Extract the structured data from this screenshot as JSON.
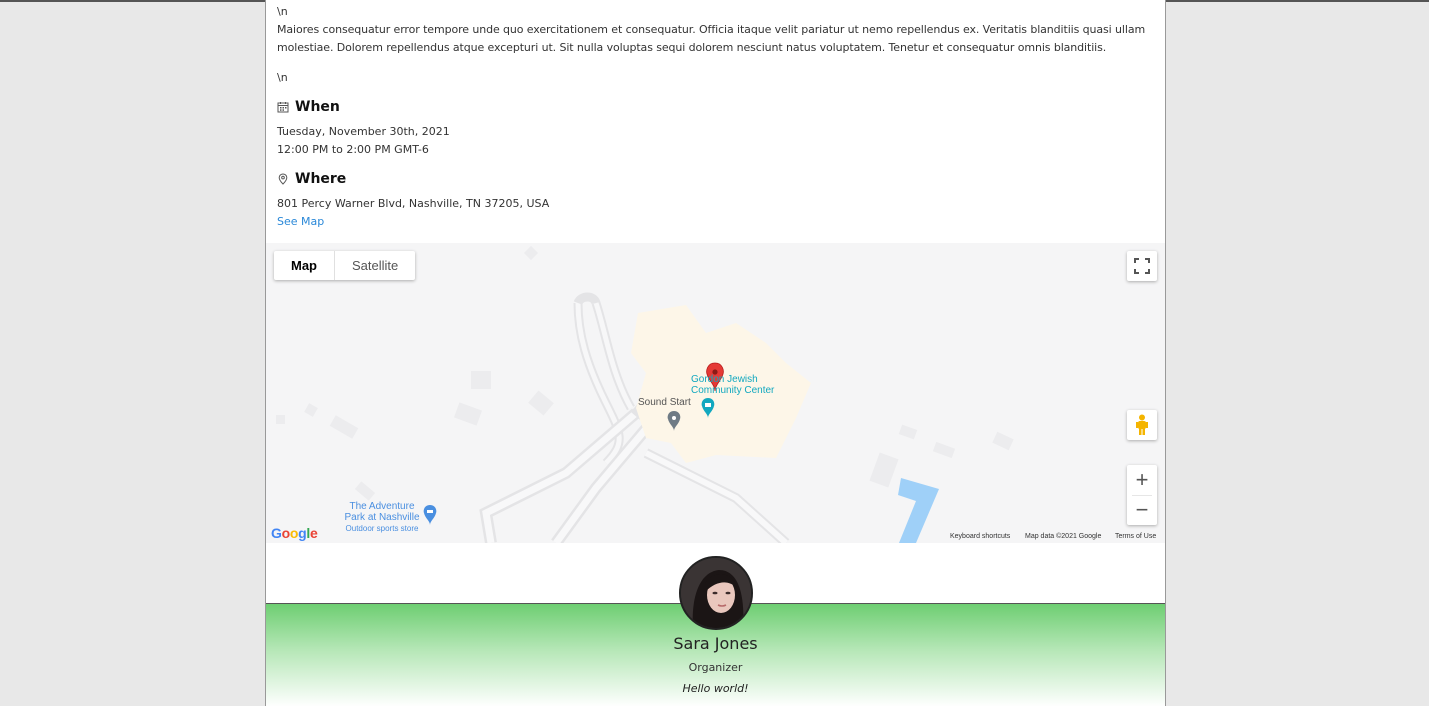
{
  "event": {
    "literal_top": "\\n",
    "description": "Maiores consequatur error tempore unde quo exercitationem et consequatur. Officia itaque velit pariatur ut nemo repellendus ex. Veritatis blanditiis quasi ullam molestiae. Dolorem repellendus atque excepturi ut. Sit nulla voluptas sequi dolorem nesciunt natus voluptatem. Tenetur et consequatur omnis blanditiis.",
    "literal_bottom": "\\n",
    "when": {
      "heading": "When",
      "icon": "calendar-icon",
      "date": "Tuesday, November 30th, 2021",
      "time": "12:00 PM to 2:00 PM GMT-6"
    },
    "where": {
      "heading": "Where",
      "icon": "location-pin-icon",
      "address": "801 Percy Warner Blvd, Nashville, TN 37205, USA",
      "see_map": "See Map"
    }
  },
  "map": {
    "type_map": "Map",
    "type_satellite": "Satellite",
    "zoom_in": "+",
    "zoom_out": "−",
    "places": {
      "gordon_line1": "Gordon Jewish",
      "gordon_line2": "Community Center",
      "sound_start": "Sound Start",
      "adventure_line1": "The Adventure",
      "adventure_line2": "Park at Nashville",
      "adventure_sub": "Outdoor sports store"
    },
    "google_logo": "Google",
    "footer": {
      "keyboard": "Keyboard shortcuts",
      "data": "Map data ©2021 Google",
      "terms": "Terms of Use"
    },
    "colors": {
      "marker": "#e53935",
      "water": "#9fd0f8",
      "building": "#fdf7ea",
      "poi_teal": "#12a8bf",
      "poi_blue": "#4a8fe0"
    }
  },
  "organizer": {
    "name": "Sara Jones",
    "role": "Organizer",
    "bio": "Hello world!",
    "gradient_top": "#6ece72"
  }
}
